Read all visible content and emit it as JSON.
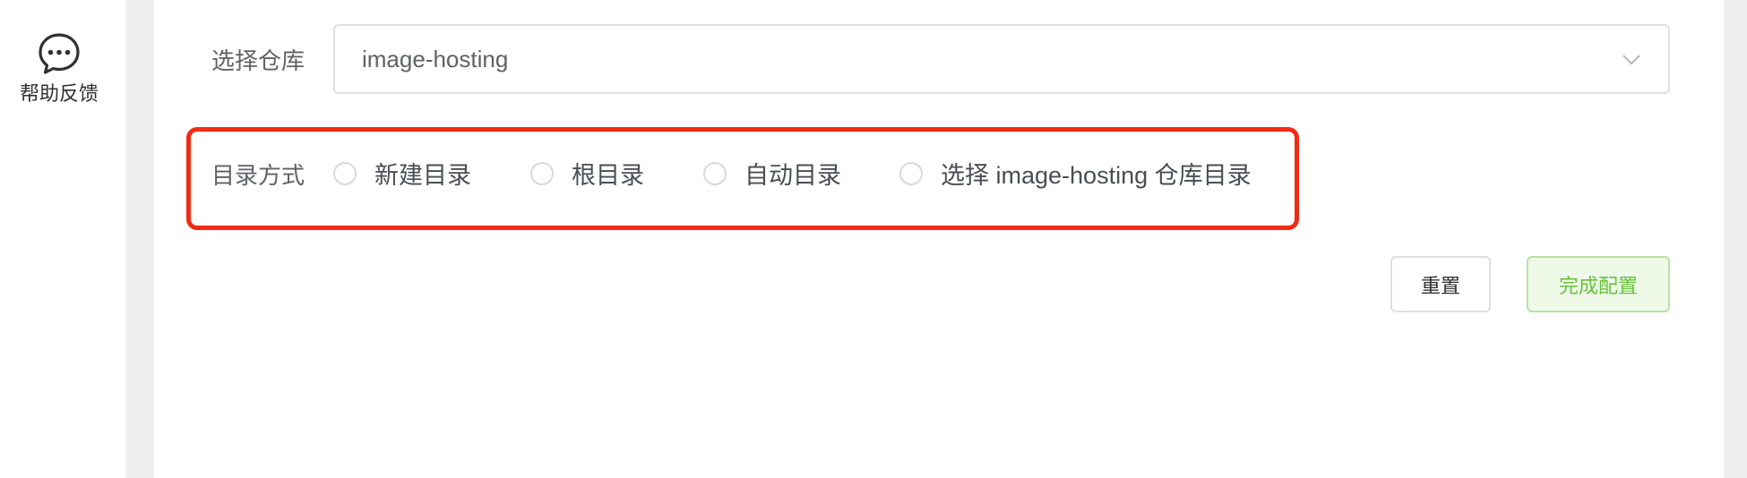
{
  "sidebar": {
    "help": {
      "icon": "chat-bubble-icon",
      "label": "帮助反馈"
    }
  },
  "form": {
    "repo": {
      "label": "选择仓库",
      "value": "image-hosting",
      "icon": "chevron-down-icon"
    },
    "directory_mode": {
      "label": "目录方式",
      "options": [
        {
          "label": "新建目录",
          "selected": false
        },
        {
          "label": "根目录",
          "selected": false
        },
        {
          "label": "自动目录",
          "selected": false
        },
        {
          "label": "选择 image-hosting 仓库目录",
          "selected": false
        }
      ],
      "highlight_color": "#f22a15"
    },
    "buttons": {
      "reset": "重置",
      "finish": "完成配置"
    }
  },
  "colors": {
    "accent_green": "#67c23a",
    "text": "#606266",
    "border": "#dcdfe6"
  }
}
